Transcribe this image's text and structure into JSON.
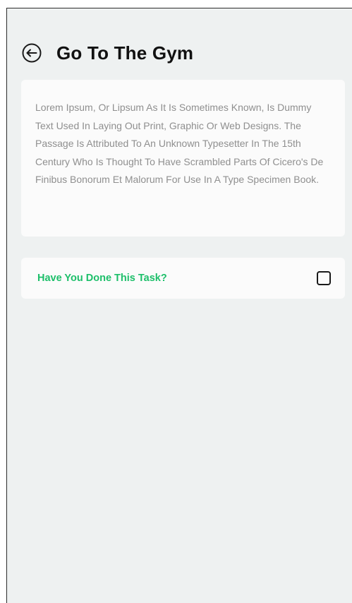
{
  "header": {
    "title": "Go To The Gym",
    "back_icon": "arrow-left-circle-icon"
  },
  "description": {
    "text": "Lorem Ipsum, Or Lipsum As It Is Sometimes Known, Is Dummy Text Used In Laying Out Print, Graphic Or Web Designs. The Passage Is Attributed To An Unknown Typesetter In The 15th Century Who Is Thought To Have Scrambled Parts Of Cicero's De Finibus Bonorum Et Malorum For Use In A Type Specimen Book."
  },
  "task": {
    "question": "Have You Done This Task?",
    "checked": false
  },
  "colors": {
    "background": "#eef1f1",
    "card": "#fbfbfb",
    "accent": "#1dbf6a",
    "title": "#111111",
    "body_text": "#8f8f8f"
  }
}
